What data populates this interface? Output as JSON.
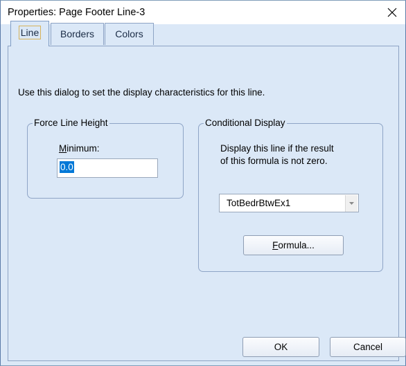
{
  "window": {
    "title": "Properties: Page Footer Line-3"
  },
  "tabs": [
    {
      "label": "Line",
      "active": true
    },
    {
      "label": "Borders",
      "active": false
    },
    {
      "label": "Colors",
      "active": false
    }
  ],
  "intro_text": "Use this dialog to set the display characteristics for this line.",
  "force_line_height": {
    "group_label": "Force Line Height",
    "minimum_label": "Minimum:",
    "minimum_mnemonic": "M",
    "minimum_rest": "inimum:",
    "minimum_value": "0.0"
  },
  "conditional_display": {
    "group_label": "Conditional Display",
    "description_line1": "Display this line if the result",
    "description_line2": "of this formula is not zero.",
    "formula_selected": "TotBedrBtwEx1",
    "formula_button_mnemonic": "F",
    "formula_button_rest": "ormula..."
  },
  "buttons": {
    "ok": "OK",
    "cancel": "Cancel"
  },
  "colors": {
    "client_background": "#dbe8f7",
    "selection_highlight": "#0078d7",
    "border": "#8da3c4"
  }
}
